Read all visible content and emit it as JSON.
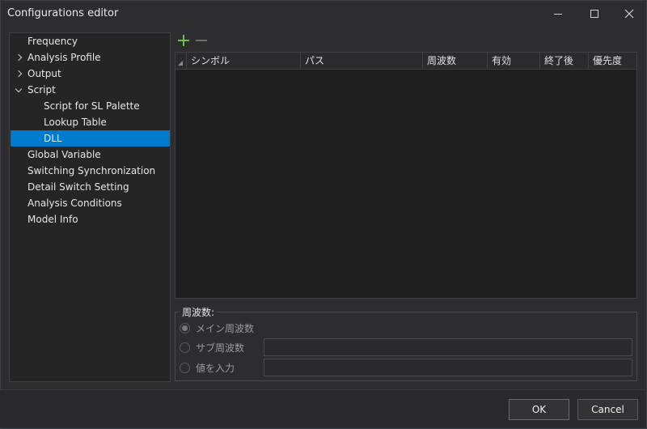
{
  "window": {
    "title": "Configurations editor",
    "controls": {
      "minimize": "minimize-icon",
      "maximize": "maximize-icon",
      "close": "close-icon"
    }
  },
  "tree": {
    "items": [
      {
        "label": "Frequency",
        "level": 0,
        "expander": "none",
        "selected": false
      },
      {
        "label": "Analysis Profile",
        "level": 0,
        "expander": "collapsed",
        "selected": false
      },
      {
        "label": "Output",
        "level": 0,
        "expander": "collapsed",
        "selected": false
      },
      {
        "label": "Script",
        "level": 0,
        "expander": "expanded",
        "selected": false
      },
      {
        "label": "Script for SL Palette",
        "level": 1,
        "expander": "none",
        "selected": false
      },
      {
        "label": "Lookup Table",
        "level": 1,
        "expander": "none",
        "selected": false
      },
      {
        "label": "DLL",
        "level": 1,
        "expander": "none",
        "selected": true
      },
      {
        "label": "Global Variable",
        "level": 0,
        "expander": "none",
        "selected": false
      },
      {
        "label": "Switching Synchronization",
        "level": 0,
        "expander": "none",
        "selected": false
      },
      {
        "label": "Detail Switch Setting",
        "level": 0,
        "expander": "none",
        "selected": false
      },
      {
        "label": "Analysis Conditions",
        "level": 0,
        "expander": "none",
        "selected": false
      },
      {
        "label": "Model Info",
        "level": 0,
        "expander": "none",
        "selected": false
      }
    ],
    "selection_color": "#007acc"
  },
  "toolbar": {
    "add_icon": "plus-icon",
    "remove_icon": "minus-icon",
    "add_color": "#6dbf4b"
  },
  "grid": {
    "columns": [
      "シンボル",
      "パス",
      "周波数",
      "有効",
      "終了後",
      "優先度"
    ],
    "rows": []
  },
  "frequency_group": {
    "title": "周波数:",
    "options": [
      {
        "label": "メイン周波数",
        "checked": true,
        "has_field": false,
        "value": ""
      },
      {
        "label": "サブ周波数",
        "checked": false,
        "has_field": true,
        "value": ""
      },
      {
        "label": "値を入力",
        "checked": false,
        "has_field": true,
        "value": ""
      }
    ]
  },
  "footer": {
    "ok_label": "OK",
    "cancel_label": "Cancel"
  }
}
